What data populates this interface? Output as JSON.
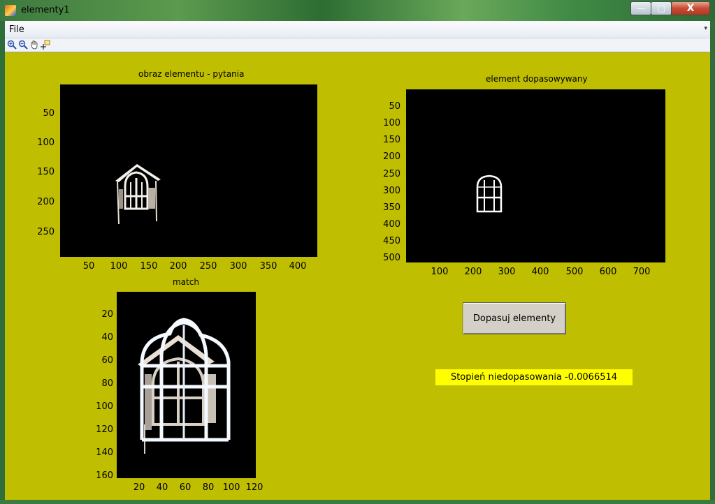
{
  "window": {
    "title": "elementy1",
    "min_glyph": "—",
    "max_glyph": "□",
    "close_glyph": "X"
  },
  "menu": {
    "file_label": "File"
  },
  "toolbar": {
    "icons": [
      "zoom-in-icon",
      "zoom-out-icon",
      "pan-hand-icon",
      "data-cursor-icon"
    ]
  },
  "axes": [
    {
      "title": "obraz elementu - pytania",
      "yticks": [
        "50",
        "100",
        "150",
        "200",
        "250"
      ],
      "xticks": [
        "50",
        "100",
        "150",
        "200",
        "250",
        "300",
        "350",
        "400"
      ]
    },
    {
      "title": "element dopasowywany",
      "yticks": [
        "50",
        "100",
        "150",
        "200",
        "250",
        "300",
        "350",
        "400",
        "450",
        "500"
      ],
      "xticks": [
        "100",
        "200",
        "300",
        "400",
        "500",
        "600",
        "700"
      ]
    },
    {
      "title": "match",
      "yticks": [
        "20",
        "40",
        "60",
        "80",
        "100",
        "120",
        "140",
        "160"
      ],
      "xticks": [
        "20",
        "40",
        "60",
        "80",
        "100",
        "120"
      ]
    }
  ],
  "button": {
    "label": "Dopasuj elementy"
  },
  "status": {
    "text": "Stopień niedopasowania -0.0066514"
  },
  "colors": {
    "figure_bg": "#c0be00",
    "status_bg": "#ffff00",
    "plot_bg": "#000000"
  }
}
